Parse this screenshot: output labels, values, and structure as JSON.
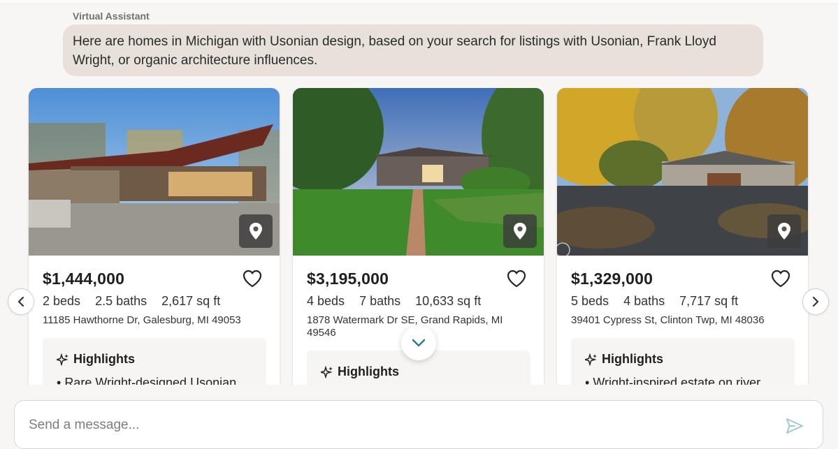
{
  "chat": {
    "sender": "Virtual Assistant",
    "message": "Here are homes in Michigan with Usonian design, based on your search for listings with Usonian, Frank Lloyd Wright, or organic architecture influences."
  },
  "listings": [
    {
      "price": "$1,444,000",
      "beds": "2 beds",
      "baths": "2.5 baths",
      "sqft": "2,617 sq ft",
      "address": "11185 Hawthorne Dr, Galesburg, MI 49053",
      "highlights_label": "Highlights",
      "highlight_first": "Rare Wright-designed Usonian",
      "photo_icon": "map-pin-icon"
    },
    {
      "price": "$3,195,000",
      "beds": "4 beds",
      "baths": "7 baths",
      "sqft": "10,633 sq ft",
      "address": "1878 Watermark Dr SE, Grand Rapids, MI 49546",
      "highlights_label": "Highlights",
      "photo_icon": "map-pin-icon"
    },
    {
      "price": "$1,329,000",
      "beds": "5 beds",
      "baths": "4 baths",
      "sqft": "7,717 sq ft",
      "address": "39401 Cypress St, Clinton Twp, MI 48036",
      "highlights_label": "Highlights",
      "highlight_first": "Wright-inspired estate on river",
      "photo_icon": "map-pin-icon"
    }
  ],
  "composer": {
    "placeholder": "Send a message..."
  },
  "colors": {
    "bubble": "#e7e1da",
    "accent_teal": "#2f7f86",
    "background": "#f8f6f4"
  }
}
